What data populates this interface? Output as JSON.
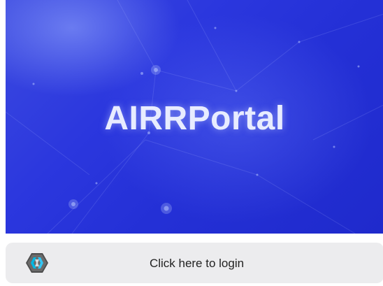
{
  "hero": {
    "title": "AIRRPortal",
    "background_color": "#2b37de",
    "image_name": "blue-network-background"
  },
  "login": {
    "label": "Click here to login",
    "icon": "keycloak-logo-icon",
    "background_color": "#ececee"
  }
}
